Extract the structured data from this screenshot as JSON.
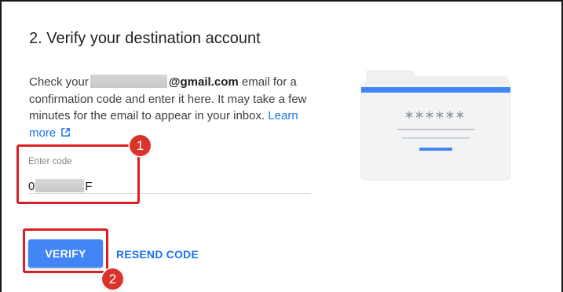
{
  "step": {
    "title": "2. Verify your destination account"
  },
  "description": {
    "prefix": "Check your",
    "email_domain": "@gmail.com",
    "middle": " email for a confirmation code and enter it here. It may take a few minutes for the email to appear in your inbox. ",
    "learn_more": "Learn more"
  },
  "code_field": {
    "label": "Enter code",
    "value_start": "0",
    "value_end": "F"
  },
  "illustration": {
    "masked_text": "******"
  },
  "buttons": {
    "verify": "VERIFY",
    "resend": "RESEND CODE"
  },
  "annotations": {
    "badge_1": "1",
    "badge_2": "2",
    "color": "#d91f26"
  },
  "colors": {
    "primary_button": "#4285f4",
    "link": "#1a73e8"
  }
}
